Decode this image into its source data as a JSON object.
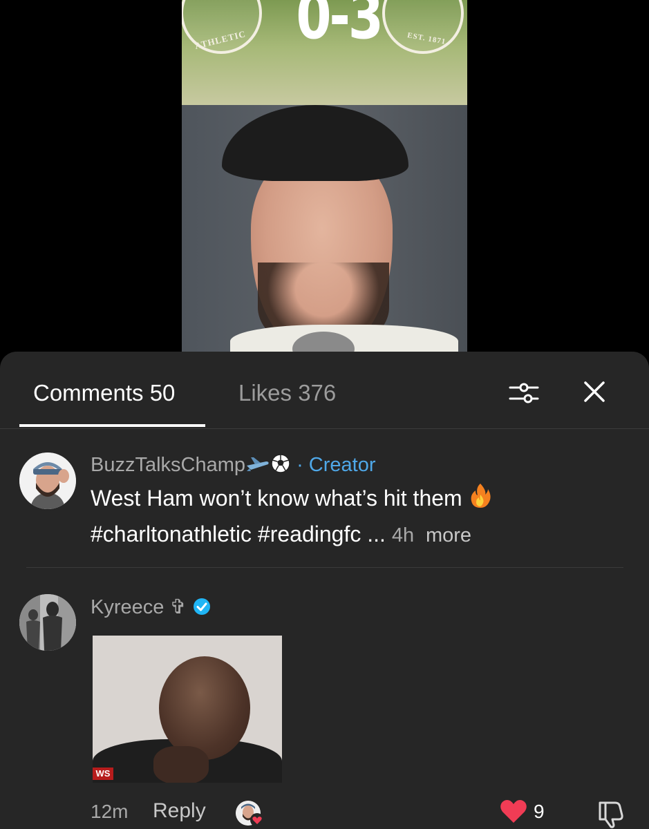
{
  "video": {
    "score": "0-3",
    "left_crest_text": "ATHLETIC",
    "right_crest_text": "EST. 1871"
  },
  "tabs": {
    "comments_label": "Comments 50",
    "likes_label": "Likes 376"
  },
  "icons": {
    "filter": "sliders-icon",
    "close": "close-icon",
    "like": "heart-icon",
    "dislike": "thumbs-down-icon",
    "verified": "verified-check-icon"
  },
  "colors": {
    "sheet_bg": "#262626",
    "creator_blue": "#4fa8e8",
    "like_red": "#f03c55"
  },
  "comments": [
    {
      "username": "BuzzTalksChamp",
      "badge_label": "· Creator",
      "text_line1": "West Ham won’t know what’s hit them",
      "text_line2": "#charltonathletic #readingfc ...",
      "time": "4h",
      "more_label": "more"
    },
    {
      "username": "Kyreece ✞",
      "gif_tag": "WS",
      "time": "12m",
      "reply_label": "Reply",
      "like_count": "9"
    }
  ]
}
